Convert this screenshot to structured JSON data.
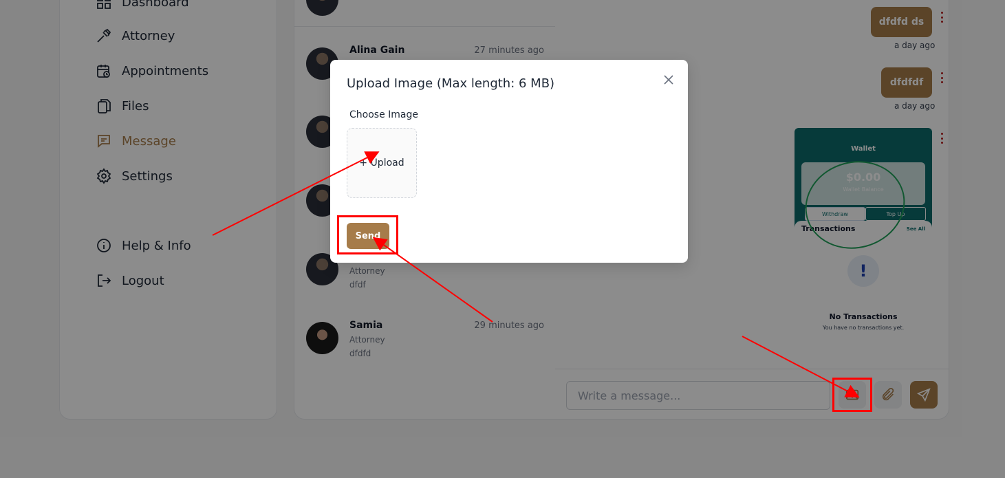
{
  "sidebar": {
    "items": [
      {
        "label": "Dashboard",
        "icon": "dashboard-icon"
      },
      {
        "label": "Attorney",
        "icon": "gavel-icon"
      },
      {
        "label": "Appointments",
        "icon": "calendar-clock-icon"
      },
      {
        "label": "Files",
        "icon": "files-icon"
      },
      {
        "label": "Message",
        "icon": "message-icon",
        "active": true
      },
      {
        "label": "Settings",
        "icon": "gear-icon"
      },
      {
        "label": "Help & Info",
        "icon": "info-icon"
      },
      {
        "label": "Logout",
        "icon": "logout-icon"
      }
    ],
    "active_color": "#a67c4a"
  },
  "conversations": [
    {
      "name": "Alina Gain",
      "time": "27 minutes ago",
      "role": "",
      "preview": ""
    },
    {
      "name": "",
      "time": "",
      "role": "Attorney",
      "preview": "dfdf"
    },
    {
      "name": "Samia",
      "time": "29 minutes ago",
      "role": "Attorney",
      "preview": "dfdfd"
    }
  ],
  "chat": {
    "messages": [
      {
        "text": "dfdfd ds",
        "time": "a day ago"
      },
      {
        "text": "dfdfdf",
        "time": "a day ago"
      }
    ],
    "image_message": {
      "title": "Wallet",
      "balance": "$0.00",
      "balance_label": "Wallet Balance",
      "withdraw": "Withdraw",
      "top_up": "Top Up",
      "transactions": "Transactions",
      "see_all": "See All",
      "empty_title": "No Transactions",
      "empty_sub": "You have no transactions yet."
    },
    "composer": {
      "placeholder": "Write a message..."
    }
  },
  "modal": {
    "title": "Upload Image (Max length: 6 MB)",
    "choose_label": "Choose Image",
    "upload_label": "+ Upload",
    "send_label": "Send"
  },
  "colors": {
    "brand": "#a67c4a",
    "annotation": "#ff0000",
    "wallet_teal": "#0b6b6b"
  }
}
